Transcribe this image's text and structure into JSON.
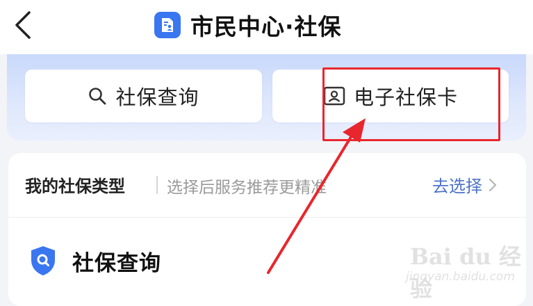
{
  "header": {
    "title": "市民中心·社保",
    "back_icon": "chevron-left-icon",
    "app_icon": "document-person-icon"
  },
  "actions": [
    {
      "label": "社保查询",
      "icon": "search-icon"
    },
    {
      "label": "电子社保卡",
      "icon": "id-card-icon"
    }
  ],
  "insurance_type": {
    "label": "我的社保类型",
    "hint": "选择后服务推荐更精准",
    "select_label": "去选择",
    "select_icon": "chevron-right-icon"
  },
  "section": {
    "title": "社保查询",
    "icon": "shield-search-icon"
  },
  "watermark": {
    "brand": "Bai du 经验",
    "site": "jingyan.baidu.com"
  },
  "colors": {
    "accent_blue": "#3a76f0",
    "link_blue": "#4c73c9",
    "annotation_red": "#e8262d",
    "panel_gradient_top": "#c9d9fb"
  }
}
